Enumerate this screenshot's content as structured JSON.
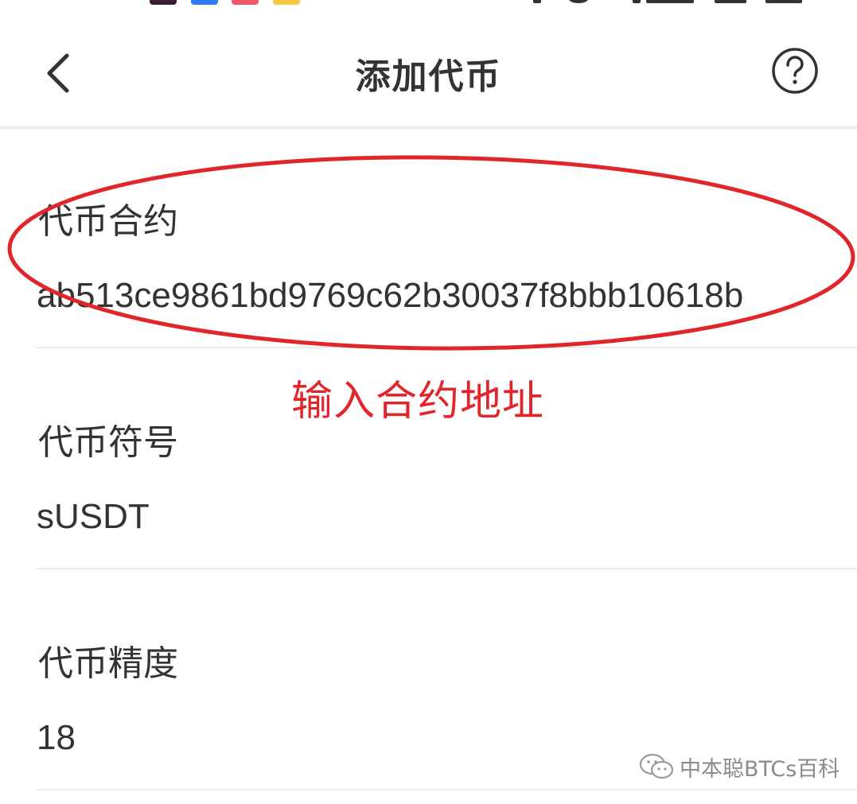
{
  "status_bar": {
    "icons": [
      "app-icon-dark",
      "app-icon-blue",
      "app-icon-red",
      "app-icon-yellow",
      "signal-icon",
      "battery-icon"
    ]
  },
  "header": {
    "title": "添加代币",
    "back_icon": "chevron-left-icon",
    "help_icon": "question-circle-icon"
  },
  "fields": [
    {
      "label": "代币合约",
      "value": "ab513ce9861bd9769c62b30037f8bbb10618b"
    },
    {
      "label": "代币符号",
      "value": "sUSDT"
    },
    {
      "label": "代币精度",
      "value": "18"
    }
  ],
  "annotation": {
    "text": "输入合约地址",
    "color": "#e0262b"
  },
  "watermark": {
    "text": "中本聪BTCs百科",
    "icon": "wechat-icon"
  }
}
